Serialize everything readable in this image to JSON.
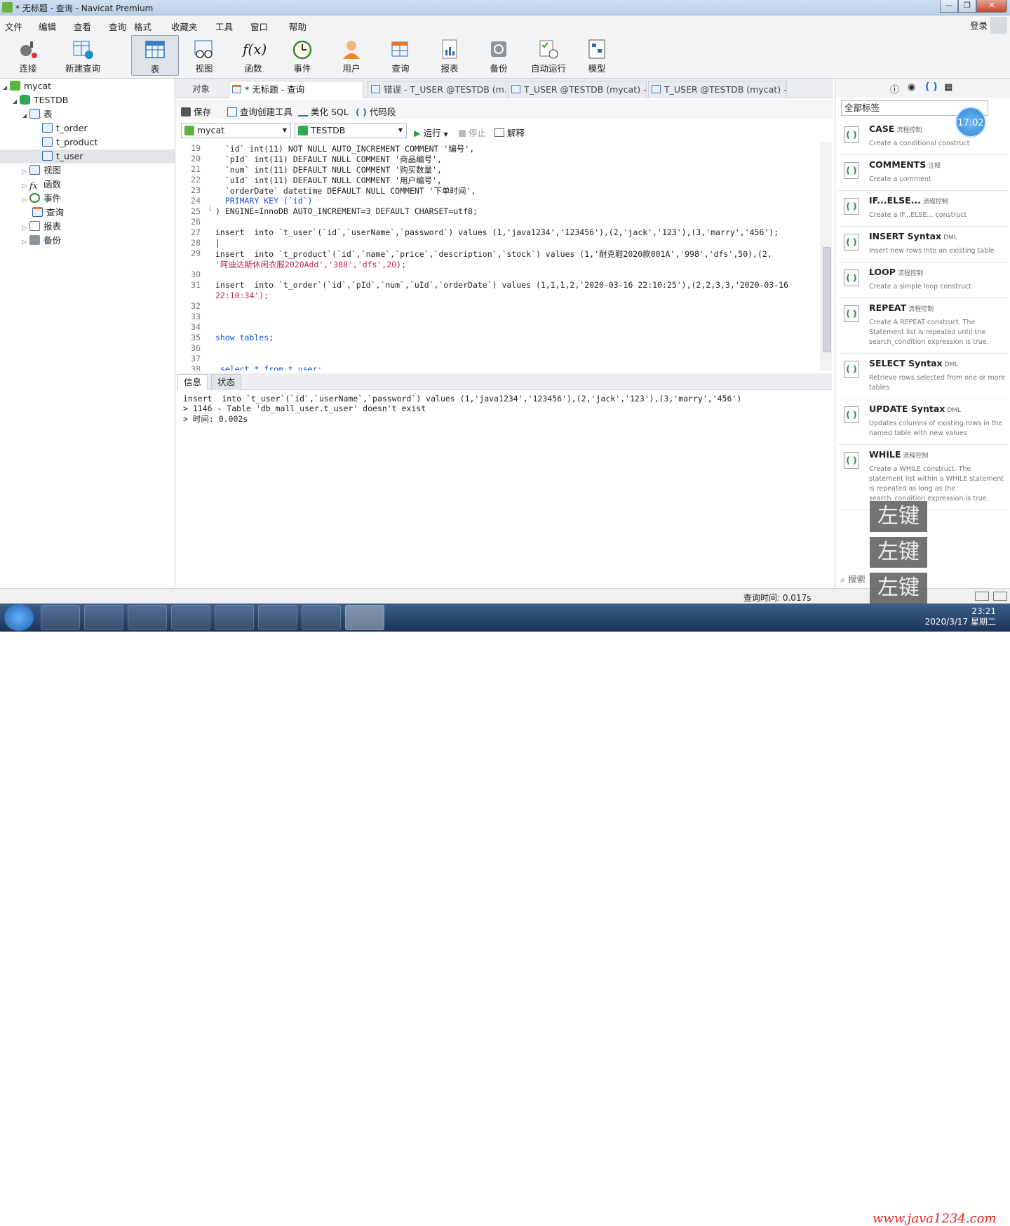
{
  "window": {
    "title": "* 无标题 - 查询 - Navicat Premium",
    "min": "—",
    "max": "❐",
    "close": "✕"
  },
  "menu": [
    "文件",
    "编辑",
    "查看",
    "查询",
    "格式",
    "收藏夹",
    "工具",
    "窗口",
    "帮助"
  ],
  "login_label": "登录",
  "toolbar": {
    "connect": "连接",
    "new_query": "新建查询",
    "table": "表",
    "view": "视图",
    "function": "函数",
    "event": "事件",
    "user": "用户",
    "query": "查询",
    "report": "报表",
    "backup": "备份",
    "schedule": "自动运行",
    "model": "模型"
  },
  "tree": {
    "connection": "mycat",
    "database": "TESTDB",
    "tables_group": "表",
    "tables": [
      "t_order",
      "t_product",
      "t_user"
    ],
    "selected_table": "t_user",
    "views": "视图",
    "functions": "函数",
    "events": "事件",
    "queries": "查询",
    "reports": "报表",
    "backups": "备份"
  },
  "tabs": [
    "对象",
    "* 无标题 - 查询",
    "错误 - T_USER @TESTDB (m...",
    "T_USER @TESTDB (mycat) - ...",
    "T_USER @TESTDB (mycat) - ..."
  ],
  "query_tools": {
    "save": "保存",
    "builder": "查询创建工具",
    "beautify": "美化 SQL",
    "snippet": "代码段"
  },
  "connection_select": "mycat",
  "database_select": "TESTDB",
  "run": {
    "run": "运行",
    "stop": "停止",
    "explain": "解释"
  },
  "editor": {
    "line_numbers": [
      "19",
      "20",
      "21",
      "22",
      "23",
      "24",
      "25",
      "26",
      "27",
      "28",
      "29",
      "",
      "30",
      "31",
      "",
      "32",
      "33",
      "34",
      "35",
      "36",
      "37",
      "38"
    ],
    "lines": [
      "  `id` int(11) NOT NULL AUTO_INCREMENT COMMENT '编号',",
      "  `pId` int(11) DEFAULT NULL COMMENT '商品编号',",
      "  `num` int(11) DEFAULT NULL COMMENT '购买数量',",
      "  `uId` int(11) DEFAULT NULL COMMENT '用户编号',",
      "  `orderDate` datetime DEFAULT NULL COMMENT '下单时间',",
      "  PRIMARY KEY (`id`)",
      ") ENGINE=InnoDB AUTO_INCREMENT=3 DEFAULT CHARSET=utf8;",
      "",
      "insert  into `t_user`(`id`,`userName`,`password`) values (1,'java1234','123456'),(2,'jack','123'),(3,'marry','456');",
      "",
      "insert  into `t_product`(`id`,`name`,`price`,`description`,`stock`) values (1,'耐克鞋2020款001A','998','dfs',50),(2,",
      "'阿迪达斯休闲衣服2020Add','388','dfs',20);",
      "",
      "insert  into `t_order`(`id`,`pId`,`num`,`uId`,`orderDate`) values (1,1,1,2,'2020-03-16 22:10:25'),(2,2,3,3,'2020-03-16",
      "22:10:34');",
      "",
      "",
      "",
      "show tables;",
      "",
      "",
      " select * from t_user;"
    ]
  },
  "bottom_tabs": [
    "信息",
    "状态"
  ],
  "output": [
    "insert  into `t_user`(`id`,`userName`,`password`) values (1,'java1234','123456'),(2,'jack','123'),(3,'marry','456')",
    "> 1146 - Table 'db_mall_user.t_user' doesn't exist",
    "> 时间: 0.002s"
  ],
  "status": {
    "query_time": "查询时间: 0.017s"
  },
  "right_panel": {
    "filter": "全部标签",
    "search_placeholder": "搜索",
    "snippets": [
      {
        "name": "CASE",
        "tag": "流程控制",
        "desc": "Create a conditional construct"
      },
      {
        "name": "COMMENTS",
        "tag": "注释",
        "desc": "Create a comment"
      },
      {
        "name": "IF...ELSE...",
        "tag": "流程控制",
        "desc": "Create a IF...ELSE... construct"
      },
      {
        "name": "INSERT Syntax",
        "tag": "DML",
        "desc": "Insert new rows into an existing table"
      },
      {
        "name": "LOOP",
        "tag": "流程控制",
        "desc": "Create a simple loop construct"
      },
      {
        "name": "REPEAT",
        "tag": "流程控制",
        "desc": "Create A REPEAT construct. The Statement list is repeated until the search_condition expression is true."
      },
      {
        "name": "SELECT Syntax",
        "tag": "DML",
        "desc": "Retrieve rows selected from one or more tables"
      },
      {
        "name": "UPDATE Syntax",
        "tag": "DML",
        "desc": "Updates columns of existing rows in the named table with new values"
      },
      {
        "name": "WHILE",
        "tag": "流程控制",
        "desc": "Create a WHILE construct. The statement list within a WHILE statement is repeated as long as the search_condition expression is true."
      }
    ]
  },
  "overlay": {
    "clock": "17:02",
    "hints": [
      "左键",
      "左键",
      "左键"
    ],
    "watermark": "www.java1234.com"
  },
  "taskbar": {
    "time": "23:21",
    "date": "2020/3/17 星期二"
  },
  "colors": {
    "keyword": "#1a53d6",
    "string": "#c4264b",
    "accent": "#2f86d8"
  }
}
